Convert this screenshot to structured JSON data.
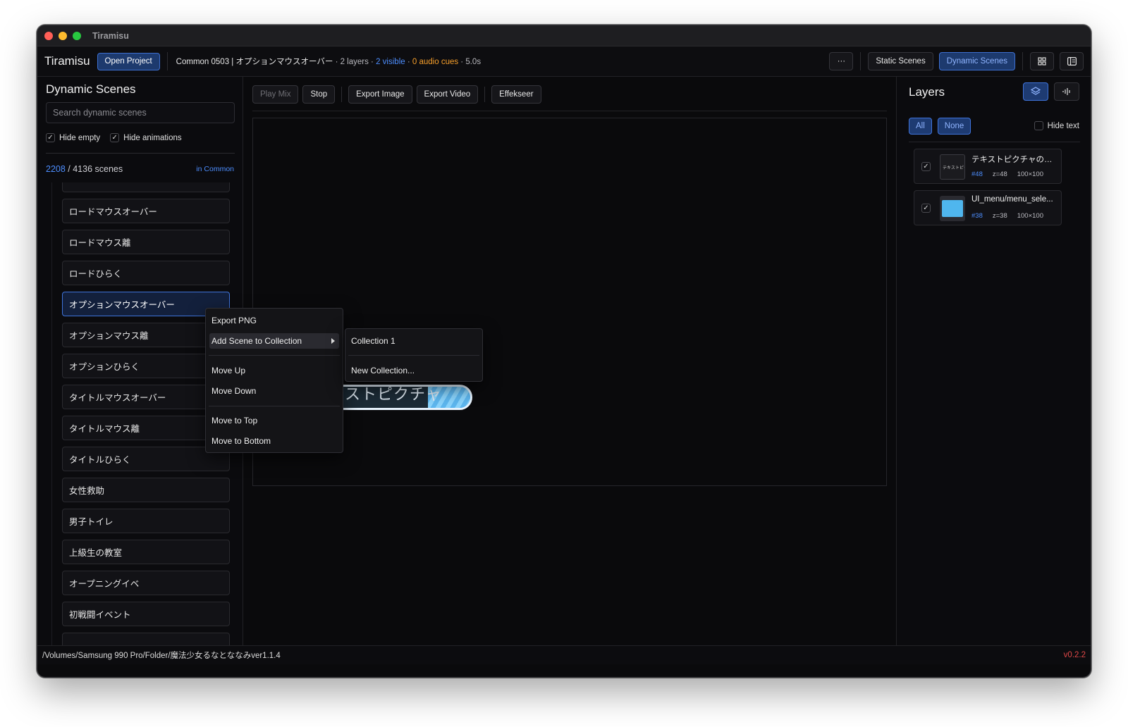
{
  "window": {
    "title": "Tiramisu"
  },
  "topbar": {
    "brand": "Tiramisu",
    "open_project": "Open Project",
    "scene_name": "Common 0503 | オプションマウスオーバー",
    "layers": " · 2 layers · ",
    "visible": "2 visible",
    "dot1": " · ",
    "audio": "0 audio cues",
    "duration": " · 5.0s",
    "more": "···",
    "static_scenes": "Static Scenes",
    "dynamic_scenes": "Dynamic Scenes"
  },
  "left": {
    "title": "Dynamic Scenes",
    "search_placeholder": "Search dynamic scenes",
    "hide_empty": "Hide empty",
    "hide_animations": "Hide animations",
    "count_shown": "2208",
    "count_total": " / 4136 scenes",
    "scope": "in Common",
    "scenes": [
      "ロードマウスオーバー",
      "ロードマウス離",
      "ロードひらく",
      "オプションマウスオーバー",
      "オプションマウス離",
      "オプションひらく",
      "タイトルマウスオーバー",
      "タイトルマウス離",
      "タイトルひらく",
      "女性救助",
      "男子トイレ",
      "上級生の教室",
      "オープニングイベ",
      "初戦闘イベント"
    ]
  },
  "toolbar": {
    "play_mix": "Play Mix",
    "stop": "Stop",
    "export_image": "Export Image",
    "export_video": "Export Video",
    "effekseer": "Effekseer"
  },
  "canvas": {
    "preview_text": "ストピクチャ"
  },
  "context_menu": {
    "export_png": "Export PNG",
    "add_to_collection": "Add Scene to Collection",
    "move_up": "Move Up",
    "move_down": "Move Down",
    "move_top": "Move to Top",
    "move_bottom": "Move to Bottom"
  },
  "submenu": {
    "collection_1": "Collection 1",
    "new_collection": "New Collection..."
  },
  "right": {
    "title": "Layers",
    "all": "All",
    "none": "None",
    "hide_text": "Hide text",
    "layers": [
      {
        "name": "テキストピクチャの設...",
        "id": "#48",
        "z": "z=48",
        "size": "100×100"
      },
      {
        "name": "UI_menu/menu_sele...",
        "id": "#38",
        "z": "z=38",
        "size": "100×100"
      }
    ]
  },
  "footer": {
    "path": "/Volumes/Samsung 990 Pro/Folder/魔法少女るなとななみver1.1.4",
    "version": "v0.2.2"
  },
  "colors": {
    "accent": "#3f74db",
    "link": "#4d8eff",
    "warning": "#f59e2a",
    "version": "#e04848"
  }
}
